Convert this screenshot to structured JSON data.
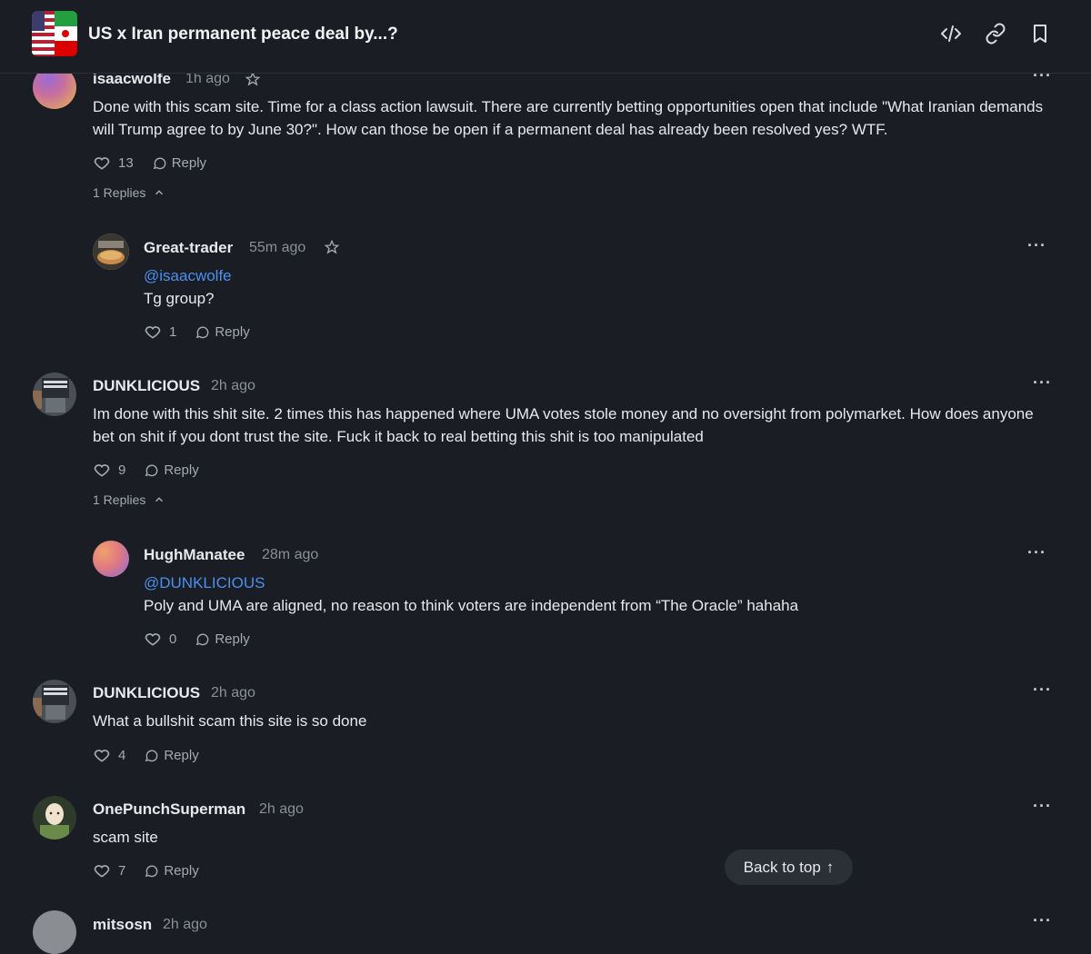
{
  "header": {
    "title": "US x Iran permanent peace deal by...?",
    "icons": [
      "embed-code-icon",
      "link-icon",
      "bookmark-icon"
    ]
  },
  "comments": [
    {
      "username": "isaacwolfe",
      "time": "1h ago",
      "text": "Done with this scam site.  Time for a class action lawsuit.  There are currently betting opportunities open that include \"What Iranian demands will Trump agree to by June 30?\".  How can those be open if a permanent deal has already been resolved yes?  WTF.",
      "likes": "13",
      "reply_label": "Reply",
      "replies_label": "1 Replies",
      "replies": [
        {
          "username": "Great-trader",
          "time": "55m ago",
          "mention": "@isaacwolfe",
          "text": "Tg group?",
          "likes": "1",
          "reply_label": "Reply"
        }
      ]
    },
    {
      "username": "DUNKLICIOUS",
      "time": "2h ago",
      "text": "Im done with this shit site. 2 times this has happened where UMA votes stole money and no oversight from polymarket. How does anyone bet on shit if you dont trust the site. Fuck it back to real betting this shit is too manipulated",
      "likes": "9",
      "reply_label": "Reply",
      "replies_label": "1 Replies",
      "replies": [
        {
          "username": "HughManatee",
          "time": "28m ago",
          "mention": "@DUNKLICIOUS",
          "text": "Poly and UMA are aligned, no reason to think voters are independent from “The Oracle” hahaha",
          "likes": "0",
          "reply_label": "Reply"
        }
      ]
    },
    {
      "username": "DUNKLICIOUS",
      "time": "2h ago",
      "text": "What a bullshit scam this site is so done",
      "likes": "4",
      "reply_label": "Reply"
    },
    {
      "username": "OnePunchSuperman",
      "time": "2h ago",
      "text": "scam site",
      "likes": "7",
      "reply_label": "Reply"
    },
    {
      "username": "mitsosn",
      "time": "2h ago"
    }
  ],
  "more_label": "···",
  "back_to_top": {
    "label": "Back to top",
    "arrow": "↑"
  },
  "colors": {
    "background": "#1a1d23",
    "mention": "#4a90f0",
    "muted": "#8a8f98"
  }
}
